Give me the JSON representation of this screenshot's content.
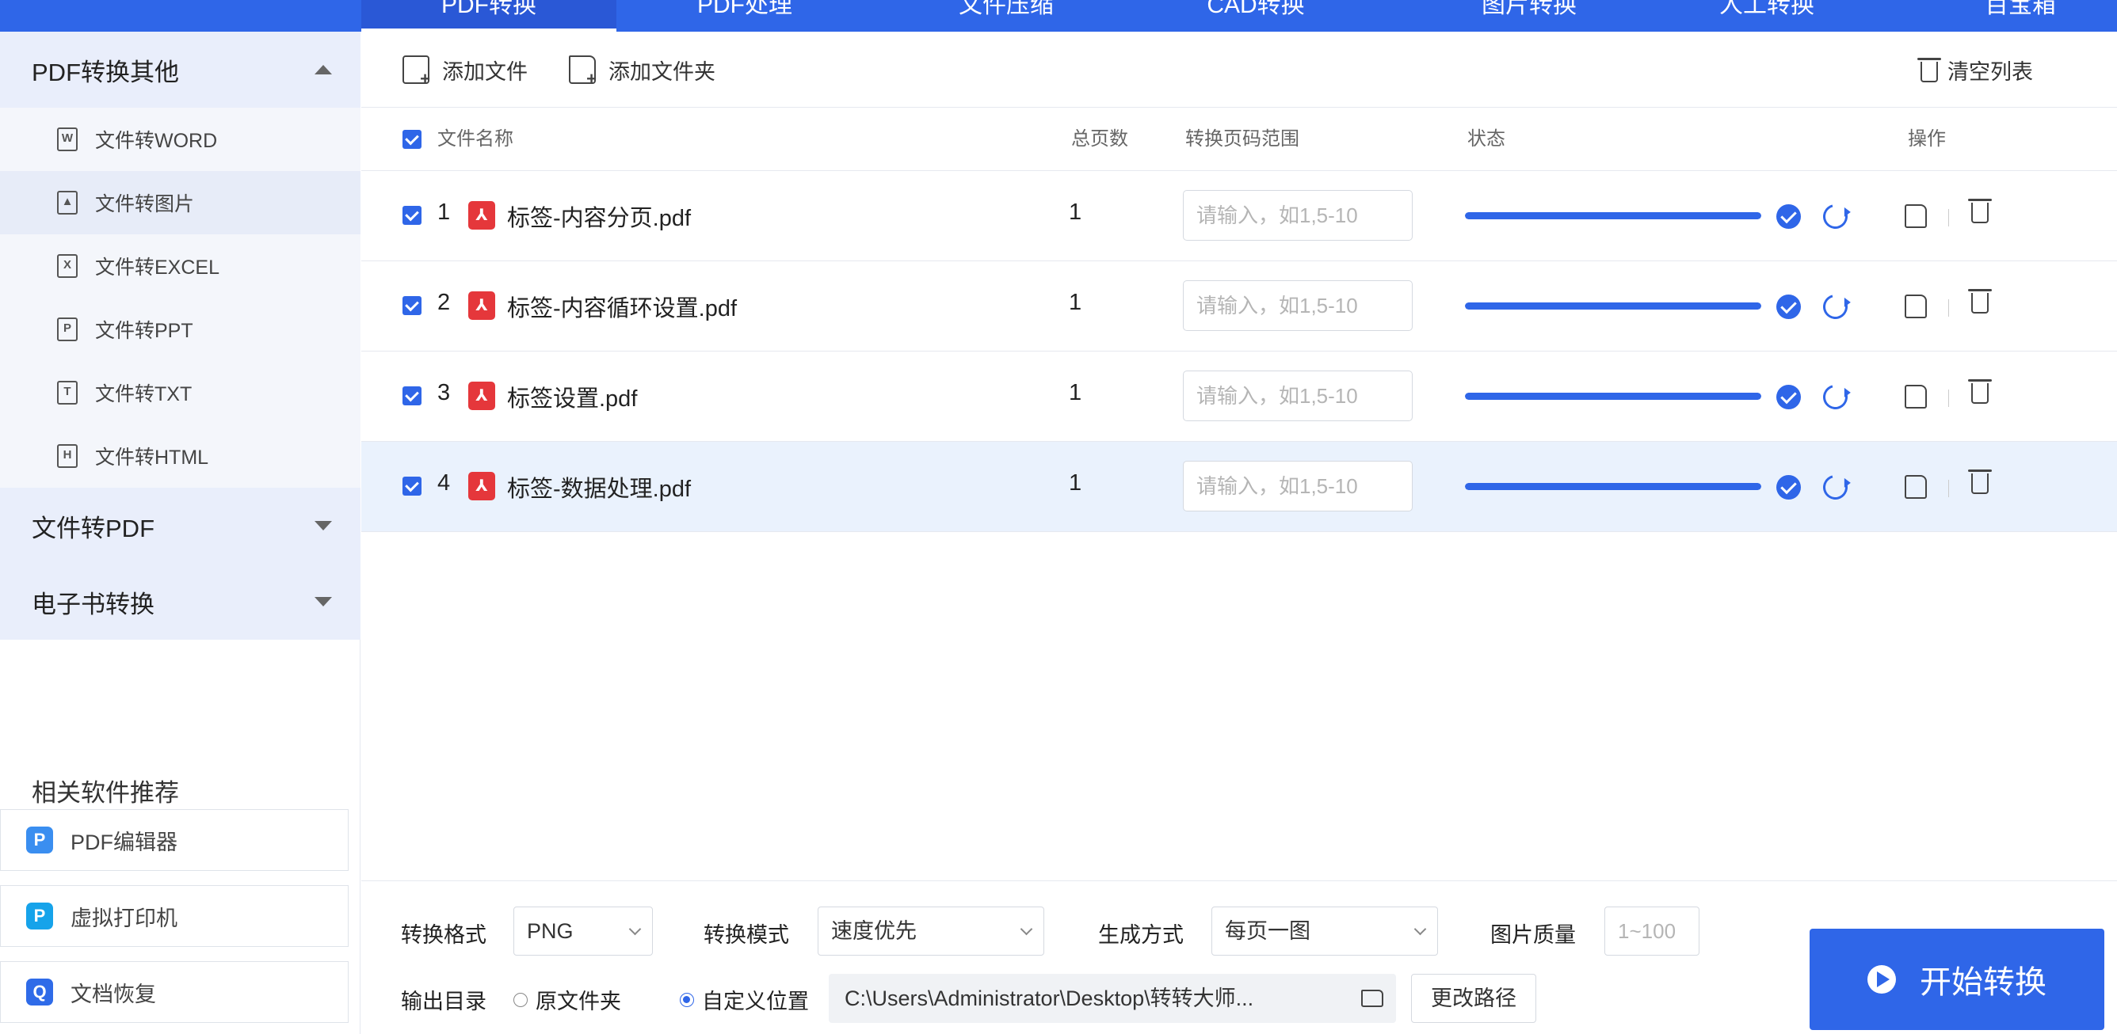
{
  "topbar": {
    "tabs": [
      {
        "label": "PDF转换",
        "active": true
      },
      {
        "label": "PDF处理",
        "active": false
      },
      {
        "label": "文件压缩",
        "active": false
      },
      {
        "label": "CAD转换",
        "active": false
      },
      {
        "label": "图片转换",
        "active": false
      },
      {
        "label": "人工转换",
        "active": false
      },
      {
        "label": "百宝箱",
        "active": false
      }
    ]
  },
  "sidebar": {
    "category_pdf_other": "PDF转换其他",
    "items": [
      {
        "label": "文件转WORD",
        "icon": "W"
      },
      {
        "label": "文件转图片",
        "icon": "img"
      },
      {
        "label": "文件转EXCEL",
        "icon": "X"
      },
      {
        "label": "文件转PPT",
        "icon": "P"
      },
      {
        "label": "文件转TXT",
        "icon": "T"
      },
      {
        "label": "文件转HTML",
        "icon": "H"
      }
    ],
    "category_to_pdf": "文件转PDF",
    "category_ebook": "电子书转换",
    "recommend_title": "相关软件推荐",
    "recommend": [
      {
        "label": "PDF编辑器"
      },
      {
        "label": "虚拟打印机"
      },
      {
        "label": "文档恢复"
      }
    ]
  },
  "toolbar": {
    "add_file": "添加文件",
    "add_folder": "添加文件夹",
    "clear_list": "清空列表"
  },
  "table": {
    "headers": {
      "name": "文件名称",
      "pages": "总页数",
      "range": "转换页码范围",
      "status": "状态",
      "actions": "操作"
    },
    "range_placeholder": "请输入，如1,5-10",
    "rows": [
      {
        "index": "1",
        "name": "标签-内容分页.pdf",
        "pages": "1",
        "progress": 1.0
      },
      {
        "index": "2",
        "name": "标签-内容循环设置.pdf",
        "pages": "1",
        "progress": 1.0
      },
      {
        "index": "3",
        "name": "标签设置.pdf",
        "pages": "1",
        "progress": 1.0
      },
      {
        "index": "4",
        "name": "标签-数据处理.pdf",
        "pages": "1",
        "progress": 1.0
      }
    ]
  },
  "settings": {
    "format_label": "转换格式",
    "format_value": "PNG",
    "mode_label": "转换模式",
    "mode_value": "速度优先",
    "gen_label": "生成方式",
    "gen_value": "每页一图",
    "quality_label": "图片质量",
    "quality_placeholder": "1~100",
    "output_label": "输出目录",
    "radio_original": "原文件夹",
    "radio_custom": "自定义位置",
    "output_path": "C:\\Users\\Administrator\\Desktop\\转转大师...",
    "change_path": "更改路径",
    "start_button": "开始转换"
  },
  "colors": {
    "accent": "#2f66e8",
    "pdf_red": "#e5373b",
    "sidebar_bg": "#e9eefb",
    "row_highlight": "#eaf2fd"
  }
}
